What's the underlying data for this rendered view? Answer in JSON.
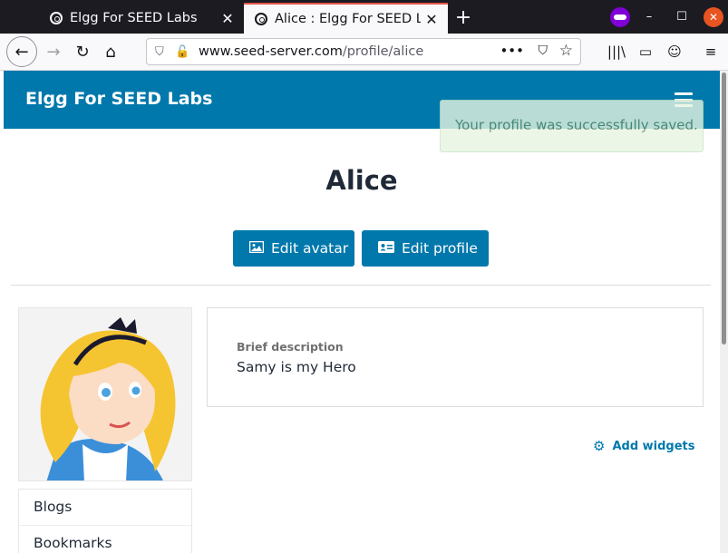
{
  "browser": {
    "tabs": [
      {
        "title": "Elgg For SEED Labs",
        "close": "✕"
      },
      {
        "title": "Alice : Elgg For SEED Labs",
        "close": "✕"
      }
    ],
    "new_tab": "+",
    "window_controls": {
      "minimize": "–",
      "maximize": "☐",
      "close": "✕"
    },
    "url_host": "www.seed-server.com",
    "url_path": "/profile/alice",
    "icons": {
      "back": "←",
      "forward": "→",
      "reload": "↻",
      "home": "⌂",
      "shield": "⛉",
      "insecure": "🔓",
      "more": "•••",
      "pocket": "⛉",
      "star": "☆",
      "library": "|||\\",
      "sidebar": "▭",
      "account": "☺",
      "menu": "≡"
    }
  },
  "site": {
    "title": "Elgg For SEED Labs",
    "system_message": "Your profile was successfully saved."
  },
  "profile": {
    "name": "Alice",
    "edit_avatar": "Edit avatar",
    "edit_profile": "Edit profile",
    "brief_description_label": "Brief description",
    "brief_description": "Samy is my Hero",
    "add_widgets": "Add widgets",
    "menu": [
      "Blogs",
      "Bookmarks"
    ]
  },
  "colors": {
    "accent": "#0078ac",
    "success_bg": "#e8f5e2",
    "success_text": "#5b8e66"
  }
}
